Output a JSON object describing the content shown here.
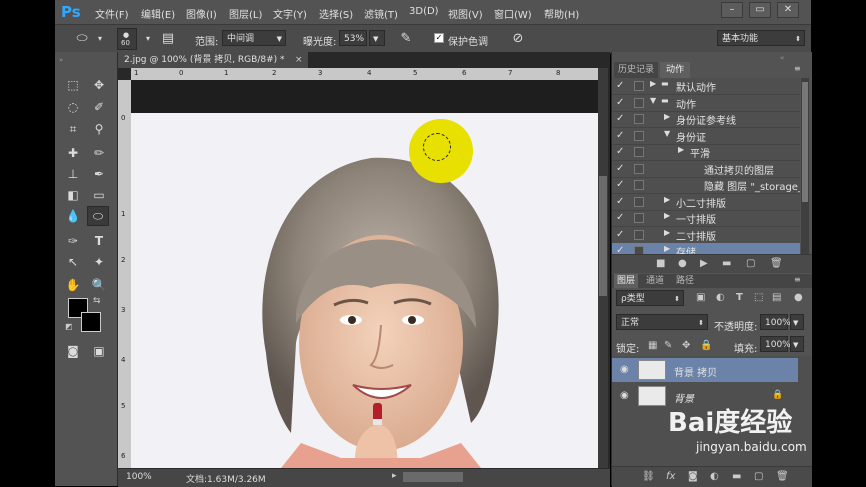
{
  "app": {
    "logo": "Ps"
  },
  "menu": [
    "文件(F)",
    "编辑(E)",
    "图像(I)",
    "图层(L)",
    "文字(Y)",
    "选择(S)",
    "滤镜(T)",
    "3D(D)",
    "视图(V)",
    "窗口(W)",
    "帮助(H)"
  ],
  "window_buttons": [
    "–",
    "▭",
    "✕"
  ],
  "options": {
    "brush_size": "60",
    "range_label": "范围:",
    "range_value": "中间调",
    "exposure_label": "曝光度:",
    "exposure_value": "53%",
    "protect_label": "保护色调",
    "workspace": "基本功能"
  },
  "document": {
    "tab_title": "2.jpg @ 100% (背景 拷贝, RGB/8#) *",
    "zoom": "100%",
    "doc_size": "文档:1.63M/3.26M",
    "ruler_top": [
      "1",
      "0",
      "1",
      "2",
      "3",
      "4",
      "5",
      "6",
      "7",
      "8"
    ],
    "ruler_left": [
      "0",
      "1",
      "2",
      "3",
      "4",
      "5",
      "6"
    ]
  },
  "panels": {
    "top_tabs": [
      "历史记录",
      "动作"
    ],
    "actions": [
      {
        "label": "默认动作",
        "indent": 0,
        "expanded": false,
        "folder": true
      },
      {
        "label": "动作",
        "indent": 0,
        "expanded": true,
        "folder": true
      },
      {
        "label": "身份证参考线",
        "indent": 1,
        "expanded": false,
        "folder": false
      },
      {
        "label": "身份证",
        "indent": 1,
        "expanded": true,
        "folder": false
      },
      {
        "label": "平滑",
        "indent": 2,
        "expanded": false,
        "folder": false
      },
      {
        "label": "通过拷贝的图层",
        "indent": 3,
        "expanded": null,
        "folder": false
      },
      {
        "label": "隐藏 图层 \"_storage_...",
        "indent": 3,
        "expanded": null,
        "folder": false
      },
      {
        "label": "小二寸排版",
        "indent": 1,
        "expanded": false,
        "folder": false
      },
      {
        "label": "一寸排版",
        "indent": 1,
        "expanded": false,
        "folder": false
      },
      {
        "label": "二寸排版",
        "indent": 1,
        "expanded": false,
        "folder": false
      },
      {
        "label": "存储",
        "indent": 1,
        "expanded": false,
        "folder": false
      }
    ],
    "layer_tabs": [
      "图层",
      "通道",
      "路径"
    ],
    "filter_kind": "ρ类型",
    "blend_mode": "正常",
    "opacity_label": "不透明度:",
    "opacity_value": "100%",
    "lock_label": "锁定:",
    "fill_label": "填充:",
    "fill_value": "100%",
    "layers": [
      {
        "name": "背景 拷贝",
        "selected": true
      },
      {
        "name": "背景",
        "selected": false
      }
    ]
  },
  "watermark": {
    "text": "Bai度经验",
    "url": "jingyan.baidu.com"
  },
  "colors": {
    "accent": "#31a8ff",
    "selected_row": "#6b83a8",
    "brush_circle": "#e8e000"
  }
}
